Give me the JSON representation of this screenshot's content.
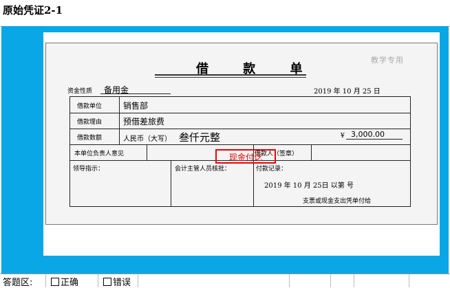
{
  "header": {
    "title": "原始凭证2-1"
  },
  "voucher": {
    "watermark": "教学专用",
    "title": "借  款  单",
    "fund_nature_label": "资金性质",
    "fund_nature_value": "备用金",
    "date": "2019  年 10 月 25 日",
    "rows": {
      "unit_label": "借款单位",
      "unit_value": "销售部",
      "reason_label": "借款理由",
      "reason_value": "预借差旅费",
      "amount_label": "借款数额",
      "amount_prefix": "人民币（大写）",
      "amount_words": "叁仟元整",
      "amount_yen": "¥",
      "amount_number": "3,000.00",
      "dept_opinion_label": "本单位负责人意见",
      "borrower_sign_label": "借款人（签章）",
      "leader_label": "领导指示：",
      "accounting_label": "会计主管人员核批：",
      "payment_label": "付款记录：",
      "payment_date": "2019  年 10 月 25日   以第        号",
      "payment_note": "支票或现金支出凭单付给"
    },
    "stamp_text": "现金付讫"
  },
  "answer": {
    "label": "答题区:",
    "correct": "正确",
    "wrong": "错误"
  }
}
